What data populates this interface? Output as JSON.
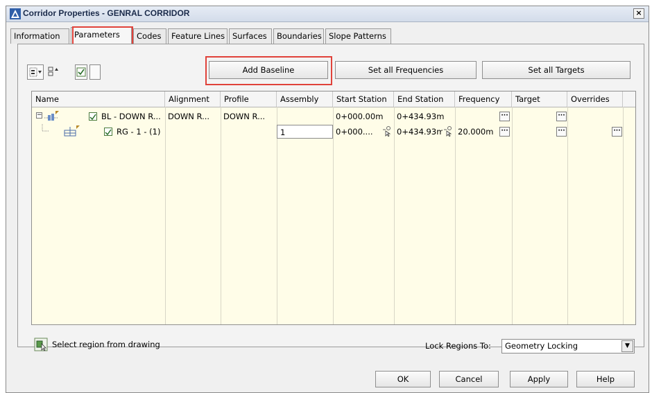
{
  "window": {
    "title": "Corridor Properties - GENRAL CORRIDOR",
    "close_label": "×"
  },
  "tabs": [
    {
      "label": "Information"
    },
    {
      "label": "Parameters"
    },
    {
      "label": "Codes"
    },
    {
      "label": "Feature Lines"
    },
    {
      "label": "Surfaces"
    },
    {
      "label": "Boundaries"
    },
    {
      "label": "Slope Patterns"
    }
  ],
  "active_tab": "Parameters",
  "toolbar": {
    "add_baseline": "Add Baseline",
    "set_all_frequencies": "Set all Frequencies",
    "set_all_targets": "Set all Targets"
  },
  "grid": {
    "columns": [
      "Name",
      "Alignment",
      "Profile",
      "Assembly",
      "Start Station",
      "End Station",
      "Frequency",
      "Target",
      "Overrides"
    ],
    "rows": [
      {
        "name": "BL - DOWN R...",
        "alignment": "DOWN R...",
        "profile": "DOWN R...",
        "assembly": "",
        "start_station": "0+000.00m",
        "end_station": "0+434.93m",
        "frequency": "",
        "target": "",
        "overrides": "",
        "checked": true
      },
      {
        "name": "RG - 1 - (1)",
        "alignment": "",
        "profile": "",
        "assembly": "1",
        "start_station": "0+000....",
        "end_station": "0+434.93m",
        "frequency": "20.000m",
        "target": "",
        "overrides": "",
        "checked": true
      }
    ],
    "ellipsis": "···"
  },
  "bottom": {
    "select_region_label": "Select region from drawing",
    "lock_regions_label": "Lock Regions To:",
    "lock_regions_value": "Geometry Locking"
  },
  "buttons": {
    "ok": "OK",
    "cancel": "Cancel",
    "apply": "Apply",
    "help": "Help"
  },
  "colors": {
    "highlight": "#e0423a",
    "grid_bg": "#fffde8",
    "title_bg": "#d3dcea"
  }
}
